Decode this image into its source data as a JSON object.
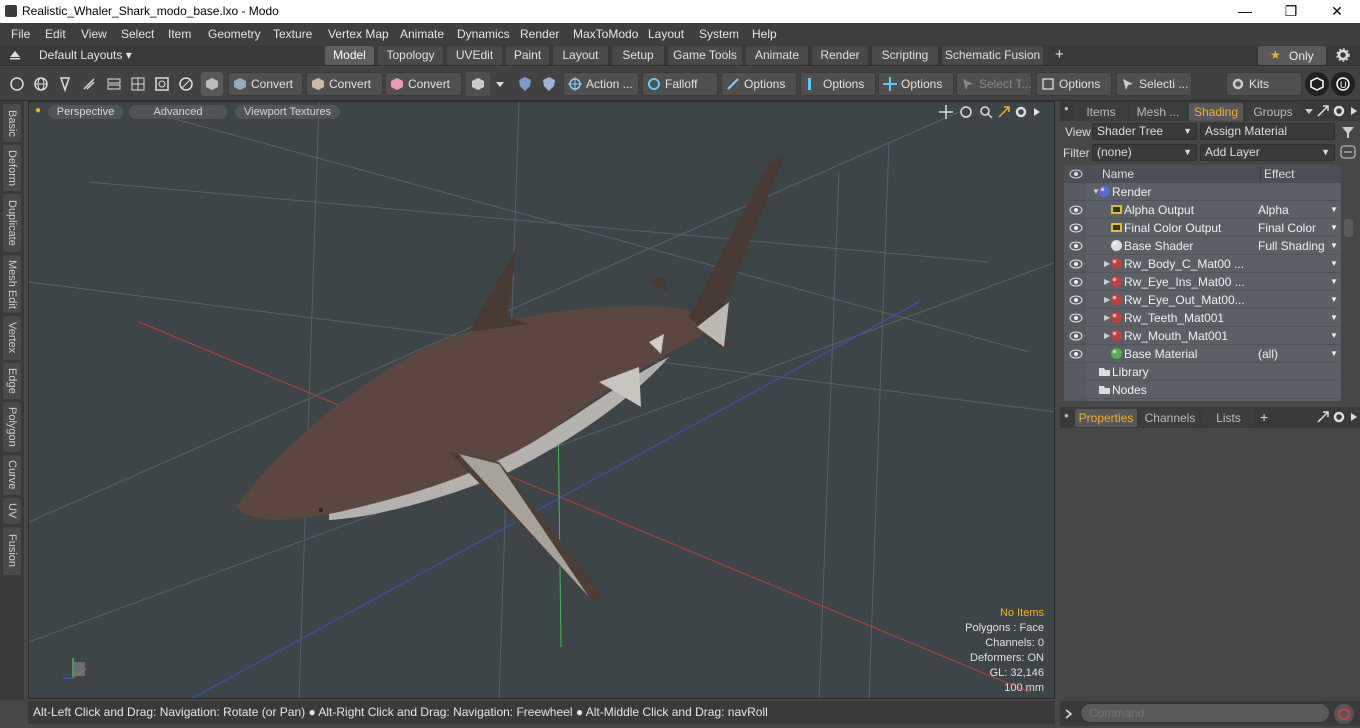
{
  "window": {
    "title": "Realistic_Whaler_Shark_modo_base.lxo - Modo",
    "minimize": "—",
    "maximize": "❐",
    "close": "✕"
  },
  "menu": [
    "File",
    "Edit",
    "View",
    "Select",
    "Item",
    "Geometry",
    "Texture",
    "Vertex Map",
    "Animate",
    "Dynamics",
    "Render",
    "MaxToModo",
    "Layout",
    "System",
    "Help"
  ],
  "layouts": {
    "dropdown": "Default Layouts ▾",
    "tabs": [
      "Model",
      "Topology",
      "UVEdit",
      "Paint",
      "Layout",
      "Setup",
      "Game Tools",
      "Animate",
      "Render",
      "Scripting",
      "Schematic Fusion"
    ],
    "active": "Model",
    "add": "+",
    "only": "Only",
    "star": "★"
  },
  "toolbar": {
    "convert1": "Convert",
    "convert2": "Convert",
    "convert3": "Convert",
    "action": "Action ...",
    "falloff": "Falloff",
    "options1": "Options",
    "options2": "Options",
    "options3": "Options",
    "select_t": "Select T...",
    "options4": "Options",
    "selecti": "Selecti ...",
    "kits": "Kits"
  },
  "left_tabs": [
    "Basic",
    "Deform",
    "Duplicate",
    "Mesh Edit",
    "Vertex",
    "Edge",
    "Polygon",
    "Curve",
    "UV",
    "Fusion"
  ],
  "viewport": {
    "perspective": "Perspective",
    "advanced": "Advanced",
    "textures": "Viewport Textures",
    "stats": {
      "no_items": "No Items",
      "polygons": "Polygons : Face",
      "channels": "Channels: 0",
      "deformers": "Deformers: ON",
      "gl": "GL: 32,146",
      "scale": "100 mm"
    }
  },
  "statusbar": "Alt-Left Click and Drag: Navigation: Rotate (or Pan) ● Alt-Right Click and Drag: Navigation: Freewheel ● Alt-Middle Click and Drag: navRoll",
  "shader_panel": {
    "tabs": [
      "Items",
      "Mesh ...",
      "Shading",
      "Groups"
    ],
    "active": "Shading",
    "view_label": "View",
    "view_value": "Shader Tree",
    "assign_material": "Assign Material",
    "filter_label": "Filter",
    "filter_value": "(none)",
    "add_layer": "Add Layer",
    "col_name": "Name",
    "col_effect": "Effect",
    "rows": [
      {
        "name": "Render",
        "effect": "",
        "indent": 0
      },
      {
        "name": "Alpha Output",
        "effect": "Alpha",
        "indent": 1
      },
      {
        "name": "Final Color Output",
        "effect": "Final Color",
        "indent": 1
      },
      {
        "name": "Base Shader",
        "effect": "Full Shading",
        "indent": 1
      },
      {
        "name": "Rw_Body_C_Mat00 ...",
        "effect": "",
        "indent": 1
      },
      {
        "name": "Rw_Eye_Ins_Mat00 ...",
        "effect": "",
        "indent": 1
      },
      {
        "name": "Rw_Eye_Out_Mat00...",
        "effect": "",
        "indent": 1
      },
      {
        "name": "Rw_Teeth_Mat001",
        "effect": "",
        "indent": 1
      },
      {
        "name": "Rw_Mouth_Mat001",
        "effect": "",
        "indent": 1
      },
      {
        "name": "Base Material",
        "effect": "(all)",
        "indent": 1
      },
      {
        "name": "Library",
        "effect": "",
        "indent": 0
      },
      {
        "name": "Nodes",
        "effect": "",
        "indent": 0
      }
    ]
  },
  "props_panel": {
    "tabs": [
      "Properties",
      "Channels",
      "Lists"
    ],
    "active": "Properties",
    "add": "+"
  },
  "command": {
    "placeholder": "Command"
  },
  "colors": {
    "accent": "#f2b322",
    "viewport_bg": "#3d4548",
    "x_axis": "#c23a3a",
    "y_axis": "#3fbf4f",
    "z_axis": "#3a4fd0"
  }
}
